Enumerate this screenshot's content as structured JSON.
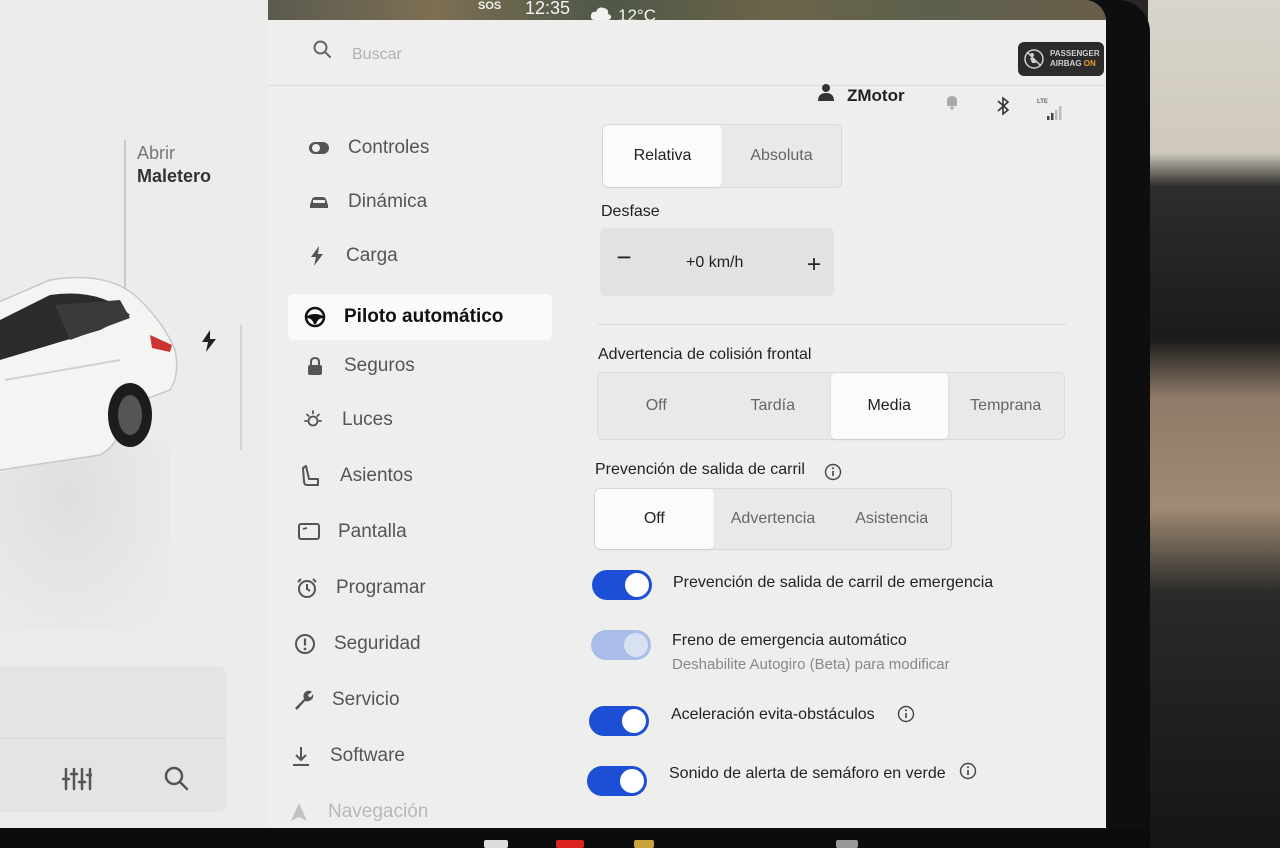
{
  "statusbar": {
    "sos": "SOS",
    "time": "12:35",
    "temperature": "12°C",
    "airbag_line1": "PASSENGER",
    "airbag_line2": "AIRBAG",
    "airbag_state": "ON"
  },
  "search": {
    "placeholder": "Buscar"
  },
  "user": {
    "name": "ZMotor",
    "lte": "LTE"
  },
  "car_panel": {
    "trunk_line1": "Abrir",
    "trunk_line2": "Maletero"
  },
  "menu": [
    {
      "label": "Controles",
      "icon": "toggle-icon"
    },
    {
      "label": "Dinámica",
      "icon": "car-icon"
    },
    {
      "label": "Carga",
      "icon": "bolt-icon"
    },
    {
      "label": "Piloto automático",
      "icon": "steering-wheel-icon",
      "active": true
    },
    {
      "label": "Seguros",
      "icon": "lock-icon"
    },
    {
      "label": "Luces",
      "icon": "sun-icon"
    },
    {
      "label": "Asientos",
      "icon": "seat-icon"
    },
    {
      "label": "Pantalla",
      "icon": "display-icon"
    },
    {
      "label": "Programar",
      "icon": "alarm-clock-icon"
    },
    {
      "label": "Seguridad",
      "icon": "alert-icon"
    },
    {
      "label": "Servicio",
      "icon": "wrench-icon"
    },
    {
      "label": "Software",
      "icon": "download-icon"
    },
    {
      "label": "Navegación",
      "icon": "navigation-icon"
    }
  ],
  "speed_mode": {
    "options": [
      "Relativa",
      "Absoluta"
    ],
    "selected": "Relativa"
  },
  "offset": {
    "label": "Desfase",
    "value": "+0 km/h",
    "minus": "−",
    "plus": "+"
  },
  "collision": {
    "label": "Advertencia de colisión frontal",
    "options": [
      "Off",
      "Tardía",
      "Media",
      "Temprana"
    ],
    "selected": "Media"
  },
  "lane": {
    "label": "Prevención de salida de carril",
    "options": [
      "Off",
      "Advertencia",
      "Asistencia"
    ],
    "selected": "Off"
  },
  "toggles": [
    {
      "label": "Prevención de salida de carril de emergencia",
      "on": true,
      "enabled": true
    },
    {
      "label": "Freno de emergencia automático",
      "sub": "Deshabilite Autogiro (Beta) para modificar",
      "on": true,
      "enabled": false
    },
    {
      "label": "Aceleración evita-obstáculos",
      "on": true,
      "enabled": true
    },
    {
      "label": "Sonido de alerta de semáforo en verde",
      "on": true,
      "enabled": true
    }
  ],
  "colors": {
    "accent": "#1d4fd6",
    "accent_disabled": "#a9bde8",
    "screen_bg": "#eeeeed"
  }
}
